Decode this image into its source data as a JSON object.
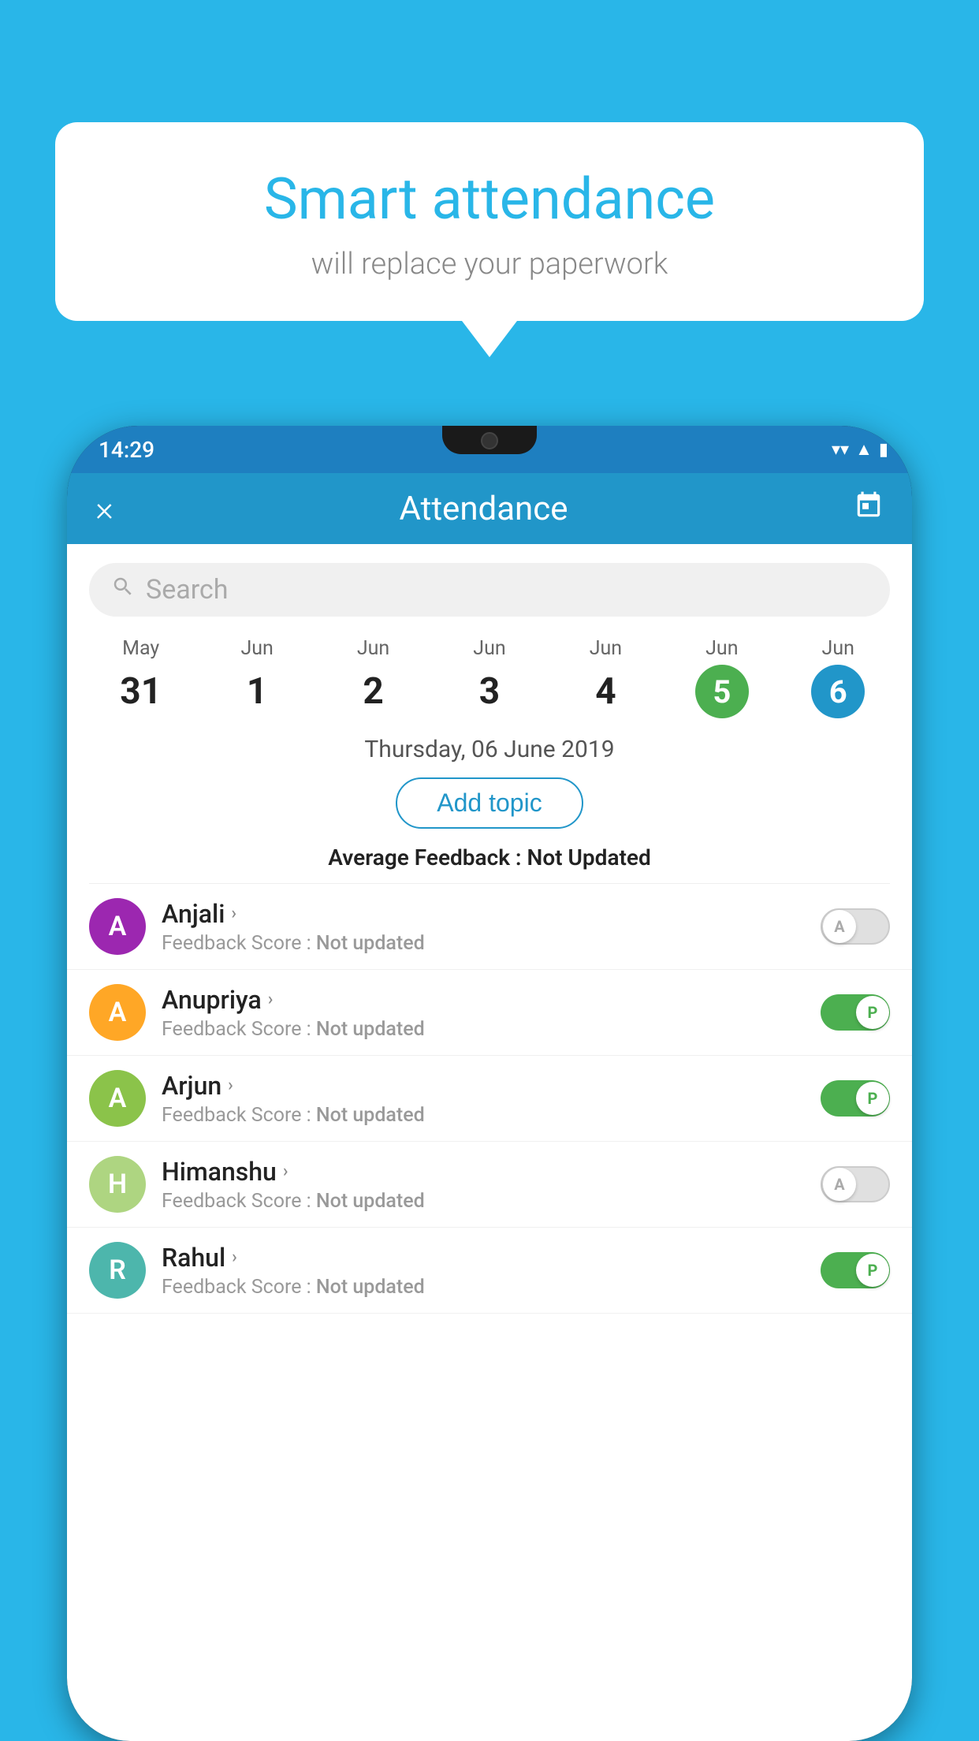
{
  "background_color": "#29b6e8",
  "bubble": {
    "title": "Smart attendance",
    "subtitle": "will replace your paperwork"
  },
  "status_bar": {
    "time": "14:29",
    "wifi_icon": "wifi",
    "signal_icon": "signal",
    "battery_icon": "battery"
  },
  "header": {
    "title": "Attendance",
    "close_icon": "×",
    "calendar_icon": "calendar"
  },
  "search": {
    "placeholder": "Search"
  },
  "calendar": {
    "days": [
      {
        "month": "May",
        "date": "31",
        "state": "normal"
      },
      {
        "month": "Jun",
        "date": "1",
        "state": "normal"
      },
      {
        "month": "Jun",
        "date": "2",
        "state": "normal"
      },
      {
        "month": "Jun",
        "date": "3",
        "state": "normal"
      },
      {
        "month": "Jun",
        "date": "4",
        "state": "normal"
      },
      {
        "month": "Jun",
        "date": "5",
        "state": "today"
      },
      {
        "month": "Jun",
        "date": "6",
        "state": "selected"
      }
    ]
  },
  "selected_date": "Thursday, 06 June 2019",
  "add_topic_label": "Add topic",
  "avg_feedback_label": "Average Feedback :",
  "avg_feedback_value": "Not Updated",
  "students": [
    {
      "name": "Anjali",
      "initial": "A",
      "avatar_color": "#9c27b0",
      "feedback_label": "Feedback Score :",
      "feedback_value": "Not updated",
      "toggle_state": "off",
      "toggle_letter": "A"
    },
    {
      "name": "Anupriya",
      "initial": "A",
      "avatar_color": "#ffa726",
      "feedback_label": "Feedback Score :",
      "feedback_value": "Not updated",
      "toggle_state": "on",
      "toggle_letter": "P"
    },
    {
      "name": "Arjun",
      "initial": "A",
      "avatar_color": "#8bc34a",
      "feedback_label": "Feedback Score :",
      "feedback_value": "Not updated",
      "toggle_state": "on",
      "toggle_letter": "P"
    },
    {
      "name": "Himanshu",
      "initial": "H",
      "avatar_color": "#aed581",
      "feedback_label": "Feedback Score :",
      "feedback_value": "Not updated",
      "toggle_state": "off",
      "toggle_letter": "A"
    },
    {
      "name": "Rahul",
      "initial": "R",
      "avatar_color": "#4db6ac",
      "feedback_label": "Feedback Score :",
      "feedback_value": "Not updated",
      "toggle_state": "on",
      "toggle_letter": "P"
    }
  ]
}
